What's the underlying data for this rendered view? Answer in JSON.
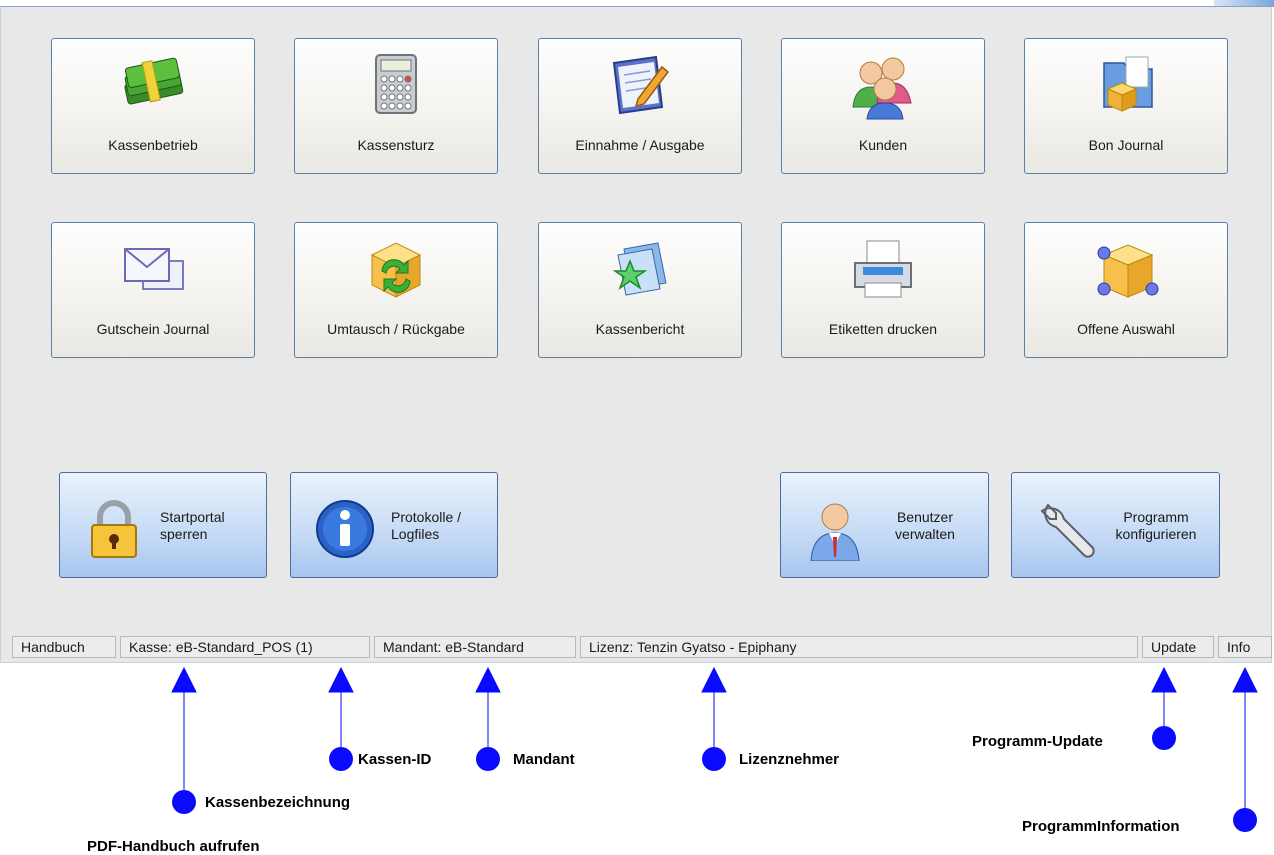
{
  "tiles": [
    {
      "label": "Kassenbetrieb",
      "icon": "money-icon"
    },
    {
      "label": "Kassensturz",
      "icon": "calculator-icon"
    },
    {
      "label": "Einnahme / Ausgabe",
      "icon": "notepad-pencil-icon"
    },
    {
      "label": "Kunden",
      "icon": "users-icon"
    },
    {
      "label": "Bon Journal",
      "icon": "folder-box-icon"
    },
    {
      "label": "Gutschein Journal",
      "icon": "envelope-icon"
    },
    {
      "label": "Umtausch / Rückgabe",
      "icon": "exchange-box-icon"
    },
    {
      "label": "Kassenbericht",
      "icon": "report-star-icon"
    },
    {
      "label": "Etiketten drucken",
      "icon": "printer-icon"
    },
    {
      "label": "Offene Auswahl",
      "icon": "cube-icon"
    }
  ],
  "buttons": {
    "lock": {
      "line1": "Startportal",
      "line2": "sperren",
      "icon": "padlock-icon"
    },
    "logs": {
      "line1": "Protokolle /",
      "line2": "Logfiles",
      "icon": "info-icon"
    },
    "users": {
      "line1": "Benutzer",
      "line2": "verwalten",
      "icon": "user-admin-icon"
    },
    "config": {
      "line1": "Programm",
      "line2": "konfigurieren",
      "icon": "wrench-icon"
    }
  },
  "statusbar": {
    "handbuch": "Handbuch",
    "kasse": "Kasse: eB-Standard_POS (1)",
    "mandant": "Mandant: eB-Standard",
    "lizenz": "Lizenz: Tenzin Gyatso - Epiphany",
    "update": "Update",
    "info": "Info"
  },
  "annotations": {
    "kassen_id": "Kassen-ID",
    "mandant": "Mandant",
    "lizenznehmer": "Lizenznehmer",
    "programm_update": "Programm-Update",
    "kassenbezeichnung": "Kassenbezeichnung",
    "programm_information": "ProgrammInformation",
    "handbuch": "PDF-Handbuch aufrufen"
  },
  "colors": {
    "marker": "#0a0aff",
    "tile_border": "#5a7fa8",
    "button_blue": "#c8dcf6"
  }
}
